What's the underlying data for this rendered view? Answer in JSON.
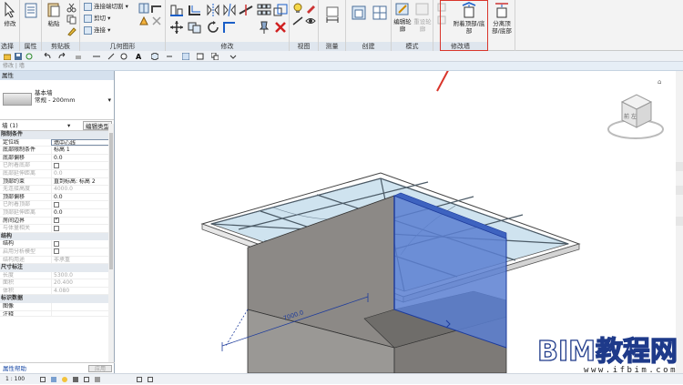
{
  "ribbon": {
    "modify_label": "修改",
    "select_label": "选择",
    "properties_label": "属性",
    "paste_label": "粘贴",
    "clipboard_label": "剪贴板",
    "connect_cut_label": "连接端切割",
    "cut_label": "剪切",
    "join_label": "连接",
    "geometry_label": "几何图形",
    "modify_panel_label": "修改",
    "view_label": "视图",
    "measure_label": "测量",
    "create_label": "创建",
    "edit_profile_label": "编辑轮廓",
    "reset_profile_label": "重设轮廓",
    "mode_label": "模式",
    "attach_label": "附着顶部/底部",
    "detach_label": "分离顶部/底部",
    "modify_wall_label": "修改墙",
    "highlight_color": "#d9352b"
  },
  "tabbar": {
    "title": "修改 | 墙"
  },
  "properties": {
    "title": "属性",
    "family": "基本墙",
    "type": "常规 - 200mm",
    "instance": "墙 (1)",
    "edit_type": "编辑类型",
    "groups": {
      "constraints": "限制条件",
      "structure": "结构",
      "dimensions": "尺寸标注",
      "identity": "标识数据"
    },
    "rows": {
      "location_line": {
        "k": "定位线",
        "v": "墙中心线"
      },
      "base_constraint": {
        "k": "底部限制条件",
        "v": "标高 1"
      },
      "base_offset": {
        "k": "底部偏移",
        "v": "0.0"
      },
      "base_attached": {
        "k": "已附着底部",
        "v": ""
      },
      "base_ext": {
        "k": "底部延伸距离",
        "v": "0.0"
      },
      "top_constraint": {
        "k": "顶部约束",
        "v": "直到标高: 标高 2"
      },
      "unconnected_h": {
        "k": "无连接高度",
        "v": "4000.0"
      },
      "top_offset": {
        "k": "顶部偏移",
        "v": "0.0"
      },
      "top_attached": {
        "k": "已附着顶部",
        "v": ""
      },
      "top_ext": {
        "k": "顶部延伸距离",
        "v": "0.0"
      },
      "room_bounding": {
        "k": "房间边界",
        "v": ""
      },
      "related_mass": {
        "k": "与体量相关",
        "v": ""
      },
      "structural": {
        "k": "结构",
        "v": ""
      },
      "analytical": {
        "k": "启用分析模型",
        "v": ""
      },
      "usage": {
        "k": "结构用途",
        "v": "非承重"
      },
      "length": {
        "k": "长度",
        "v": "5300.0"
      },
      "area": {
        "k": "面积",
        "v": "20.400"
      },
      "volume": {
        "k": "体积",
        "v": "4.080"
      },
      "image": {
        "k": "图像",
        "v": ""
      },
      "comment": {
        "k": "注释",
        "v": ""
      }
    },
    "help": "属性帮助",
    "apply": "应用"
  },
  "view": {
    "dimension": "7000.0",
    "viewcube_face": "前 左"
  },
  "status": {
    "scale": "1 : 100"
  },
  "watermark": {
    "big": "BIM教程网",
    "url": "www.ifbim.com"
  }
}
